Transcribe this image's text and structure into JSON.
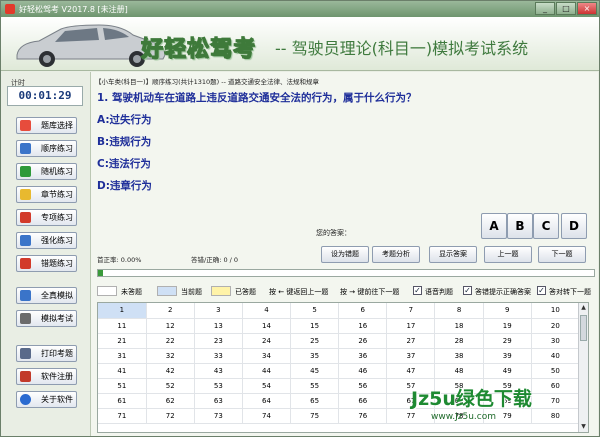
{
  "window": {
    "title": "好轻松驾考 V2017.8 [未注册]",
    "controls": [
      "_",
      "□",
      "×"
    ]
  },
  "header": {
    "brand": "好轻松驾考",
    "subtitle": "-- 驾驶员理论(科目一)模拟考试系统"
  },
  "sidebar": {
    "timer_label": "计时",
    "timer": "00:01:29",
    "items": [
      {
        "label": "题库选择",
        "icon": "color-cubes-icon",
        "color": "#e74c3c"
      },
      {
        "label": "顺序练习",
        "icon": "list-check-icon",
        "color": "#3a74c9"
      },
      {
        "label": "随机练习",
        "icon": "shuffle-icon",
        "color": "#2e9a3a"
      },
      {
        "label": "章节练习",
        "icon": "folder-icon",
        "color": "#e8b92f"
      },
      {
        "label": "专项练习",
        "icon": "target-icon",
        "color": "#d23a2a"
      },
      {
        "label": "强化练习",
        "icon": "chart-icon",
        "color": "#3a74c9"
      },
      {
        "label": "错题练习",
        "icon": "flag-icon",
        "color": "#d23a2a"
      },
      {
        "label": "全真模拟",
        "icon": "grid-icon",
        "color": "#3a74c9"
      },
      {
        "label": "模拟考试",
        "icon": "document-icon",
        "color": "#6b6b6b"
      },
      {
        "label": "打印考题",
        "icon": "printer-icon",
        "color": "#5a6a8a"
      },
      {
        "label": "软件注册",
        "icon": "pen-icon",
        "color": "#c23a2a"
      },
      {
        "label": "关于软件",
        "icon": "info-icon",
        "color": "#2a6ad0"
      }
    ]
  },
  "main": {
    "breadcrumb": "【小车类(科目一)】顺序练习(共计1310题) -- 道路交通安全法律、法规和规章",
    "question": "1. 驾驶机动车在道路上违反道路交通安全法的行为，属于什么行为？",
    "options": [
      "A:过失行为",
      "B:违规行为",
      "C:违法行为",
      "D:违章行为"
    ],
    "your_answer_label": "您的答案：",
    "answer_buttons": [
      "A",
      "B",
      "C",
      "D"
    ],
    "accuracy": "首正率: 0.00%",
    "wrong_correct": "答错/正确: 0 / 0",
    "actions": [
      "设为错题",
      "考题分析",
      "显示答案",
      "上一题",
      "下一题"
    ],
    "progress": 0.002,
    "legend": {
      "unanswered": "未答题",
      "current": "当前题",
      "answered": "已答题",
      "hint_prev": "按 ← 键返回上一题",
      "hint_next": "按 → 键前往下一题",
      "voice": "语音判题",
      "show_correct": "答错提示正确答案",
      "auto_next": "答对转下一题"
    },
    "legend_colors": {
      "unanswered": "#ffffff",
      "current": "#cfe0f5",
      "answered": "#fff3a8"
    },
    "grid": [
      [
        "1",
        "2",
        "3",
        "4",
        "5",
        "6",
        "7",
        "8",
        "9",
        "10"
      ],
      [
        "11",
        "12",
        "13",
        "14",
        "15",
        "16",
        "17",
        "18",
        "19",
        "20"
      ],
      [
        "21",
        "22",
        "23",
        "24",
        "25",
        "26",
        "27",
        "28",
        "29",
        "30"
      ],
      [
        "31",
        "32",
        "33",
        "34",
        "35",
        "36",
        "37",
        "38",
        "39",
        "40"
      ],
      [
        "41",
        "42",
        "43",
        "44",
        "45",
        "46",
        "47",
        "48",
        "49",
        "50"
      ],
      [
        "51",
        "52",
        "53",
        "54",
        "55",
        "56",
        "57",
        "58",
        "59",
        "60"
      ],
      [
        "61",
        "62",
        "63",
        "64",
        "65",
        "66",
        "67",
        "68",
        "69",
        "70"
      ],
      [
        "71",
        "72",
        "73",
        "74",
        "75",
        "76",
        "77",
        "78",
        "79",
        "80"
      ]
    ]
  },
  "watermark": {
    "text": "Jz5u绿色下载",
    "url": "www.Jz5u.com"
  }
}
